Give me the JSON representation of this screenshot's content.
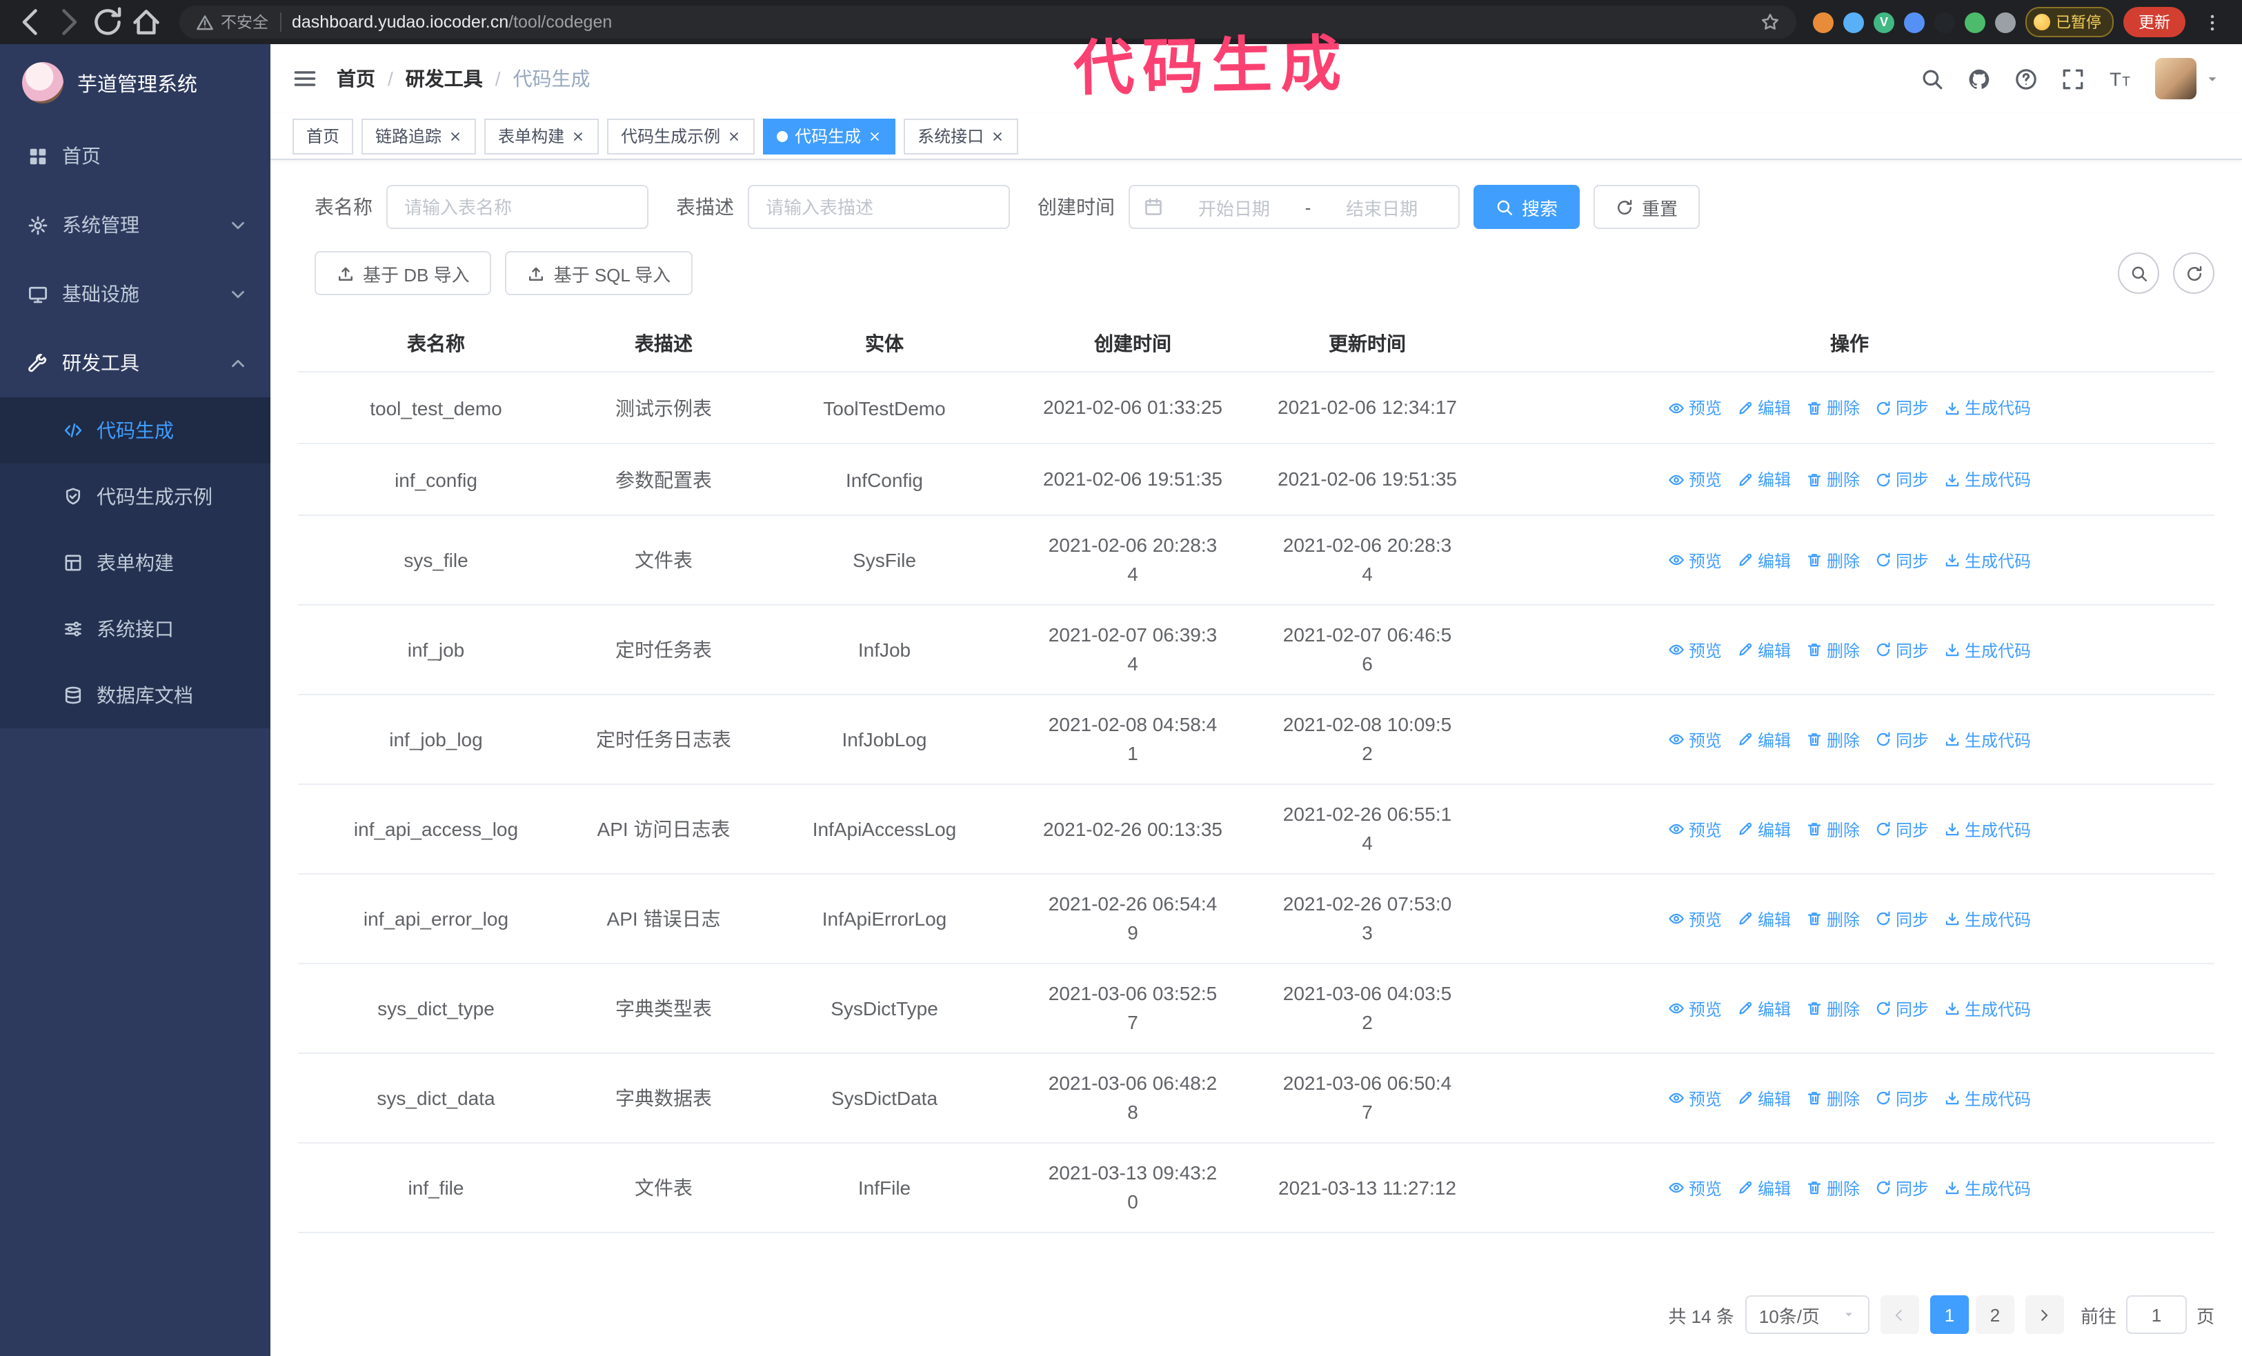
{
  "colors": {
    "accent": "#409eff",
    "sidebar_bg": "#2d3a5e",
    "sidebar_submenu_bg": "#243150",
    "annotation": "#fb4171",
    "update_button_bg": "#d23f31",
    "table_border": "#ebeef5"
  },
  "chrome": {
    "security_warning": "不安全",
    "url_domain": "dashboard.yudao.iocoder.cn",
    "url_path": "/tool/codegen",
    "extensions": [
      {
        "color": "#e98c3a",
        "letter": ""
      },
      {
        "color": "#59b0f6",
        "letter": ""
      },
      {
        "color": "#41b883",
        "letter": "V"
      },
      {
        "color": "#5591f5",
        "letter": ""
      },
      {
        "color": "#23262b",
        "letter": ""
      },
      {
        "color": "#4cbb6c",
        "letter": ""
      },
      {
        "color": "#9aa0a6",
        "letter": ""
      }
    ],
    "paused_badge": "已暂停",
    "update_button": "更新"
  },
  "annotation": {
    "text": "代码生成",
    "color": "#fb4171"
  },
  "sidebar": {
    "logo_title": "芋道管理系统",
    "items": [
      {
        "key": "home",
        "label": "首页",
        "icon": "dashboard",
        "expandable": false,
        "expanded": false
      },
      {
        "key": "system",
        "label": "系统管理",
        "icon": "gear",
        "expandable": true,
        "expanded": false
      },
      {
        "key": "infra",
        "label": "基础设施",
        "icon": "monitor",
        "expandable": true,
        "expanded": false
      },
      {
        "key": "devtools",
        "label": "研发工具",
        "icon": "tools",
        "expandable": true,
        "expanded": true,
        "children": [
          {
            "key": "codegen",
            "label": "代码生成",
            "icon": "code",
            "active": true
          },
          {
            "key": "codegen-example",
            "label": "代码生成示例",
            "icon": "example",
            "active": false
          },
          {
            "key": "form-builder",
            "label": "表单构建",
            "icon": "form",
            "active": false
          },
          {
            "key": "system-api",
            "label": "系统接口",
            "icon": "api",
            "active": false
          },
          {
            "key": "db-doc",
            "label": "数据库文档",
            "icon": "database",
            "active": false
          }
        ]
      }
    ]
  },
  "header": {
    "breadcrumb": [
      "首页",
      "研发工具",
      "代码生成"
    ]
  },
  "tabs": [
    {
      "key": "home",
      "label": "首页",
      "closable": false,
      "active": false
    },
    {
      "key": "trace",
      "label": "链路追踪",
      "closable": true,
      "active": false
    },
    {
      "key": "form-builder",
      "label": "表单构建",
      "closable": true,
      "active": false
    },
    {
      "key": "codegen-example",
      "label": "代码生成示例",
      "closable": true,
      "active": false
    },
    {
      "key": "codegen",
      "label": "代码生成",
      "closable": true,
      "active": true
    },
    {
      "key": "system-api",
      "label": "系统接口",
      "closable": true,
      "active": false
    }
  ],
  "filters": {
    "table_name_label": "表名称",
    "table_name_placeholder": "请输入表名称",
    "table_desc_label": "表描述",
    "table_desc_placeholder": "请输入表描述",
    "create_time_label": "创建时间",
    "date_start_placeholder": "开始日期",
    "date_separator": "-",
    "date_end_placeholder": "结束日期",
    "search_button": "搜索",
    "reset_button": "重置"
  },
  "toolbar": {
    "import_db": "基于 DB 导入",
    "import_sql": "基于 SQL 导入"
  },
  "table": {
    "columns": [
      "表名称",
      "表描述",
      "实体",
      "创建时间",
      "更新时间",
      "操作"
    ],
    "actions": [
      {
        "key": "preview",
        "label": "预览",
        "icon": "eye"
      },
      {
        "key": "edit",
        "label": "编辑",
        "icon": "edit"
      },
      {
        "key": "delete",
        "label": "删除",
        "icon": "delete"
      },
      {
        "key": "sync",
        "label": "同步",
        "icon": "sync"
      },
      {
        "key": "generate",
        "label": "生成代码",
        "icon": "download"
      }
    ],
    "rows": [
      {
        "name": "tool_test_demo",
        "desc": "测试示例表",
        "entity": "ToolTestDemo",
        "created": "2021-02-06 01:33:25",
        "updated": "2021-02-06 12:34:17"
      },
      {
        "name": "inf_config",
        "desc": "参数配置表",
        "entity": "InfConfig",
        "created": "2021-02-06 19:51:35",
        "updated": "2021-02-06 19:51:35"
      },
      {
        "name": "sys_file",
        "desc": "文件表",
        "entity": "SysFile",
        "created": "2021-02-06 20:28:3\n4",
        "updated": "2021-02-06 20:28:3\n4"
      },
      {
        "name": "inf_job",
        "desc": "定时任务表",
        "entity": "InfJob",
        "created": "2021-02-07 06:39:3\n4",
        "updated": "2021-02-07 06:46:5\n6"
      },
      {
        "name": "inf_job_log",
        "desc": "定时任务日志表",
        "entity": "InfJobLog",
        "created": "2021-02-08 04:58:4\n1",
        "updated": "2021-02-08 10:09:5\n2"
      },
      {
        "name": "inf_api_access_log",
        "desc": "API 访问日志表",
        "entity": "InfApiAccessLog",
        "created": "2021-02-26 00:13:35",
        "updated": "2021-02-26 06:55:1\n4"
      },
      {
        "name": "inf_api_error_log",
        "desc": "API 错误日志",
        "entity": "InfApiErrorLog",
        "created": "2021-02-26 06:54:4\n9",
        "updated": "2021-02-26 07:53:0\n3"
      },
      {
        "name": "sys_dict_type",
        "desc": "字典类型表",
        "entity": "SysDictType",
        "created": "2021-03-06 03:52:5\n7",
        "updated": "2021-03-06 04:03:5\n2"
      },
      {
        "name": "sys_dict_data",
        "desc": "字典数据表",
        "entity": "SysDictData",
        "created": "2021-03-06 06:48:2\n8",
        "updated": "2021-03-06 06:50:4\n7"
      },
      {
        "name": "inf_file",
        "desc": "文件表",
        "entity": "InfFile",
        "created": "2021-03-13 09:43:2\n0",
        "updated": "2021-03-13 11:27:12"
      }
    ]
  },
  "pagination": {
    "total_text": "共 14 条",
    "page_size": "10条/页",
    "pages": [
      "1",
      "2"
    ],
    "active_page": "1",
    "goto_label": "前往",
    "goto_value": "1",
    "goto_suffix": "页"
  }
}
